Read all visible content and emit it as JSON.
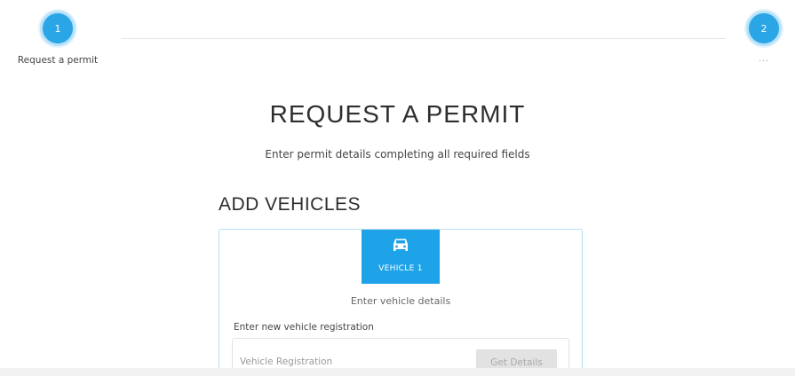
{
  "stepper": {
    "steps": [
      {
        "number": "1",
        "label": "Request a permit"
      },
      {
        "number": "2",
        "label": "..."
      }
    ]
  },
  "page": {
    "title": "REQUEST A PERMIT",
    "subtitle": "Enter permit details completing all required fields"
  },
  "vehicles": {
    "section_title": "ADD VEHICLES",
    "tab": {
      "icon": "car-icon",
      "label": "VEHICLE 1"
    },
    "instructions": "Enter vehicle details",
    "registration_label": "Enter new vehicle registration",
    "registration_input": {
      "value": "",
      "placeholder": "Vehicle Registration"
    },
    "get_details_label": "Get Details"
  },
  "colors": {
    "accent": "#1fa3e8",
    "card_border": "#b6def3",
    "disabled_button": "#e2e2e2"
  }
}
